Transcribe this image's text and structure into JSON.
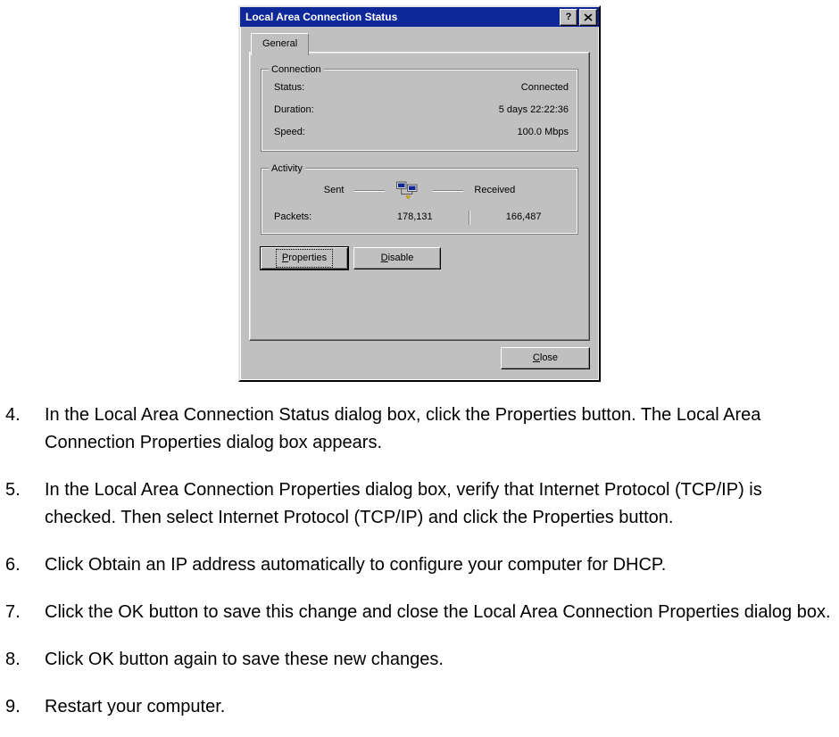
{
  "dialog": {
    "title": "Local Area Connection Status",
    "help_glyph": "?",
    "close_glyph": "×",
    "tab_general": "General",
    "group_connection": "Connection",
    "status_label": "Status:",
    "status_value": "Connected",
    "duration_label": "Duration:",
    "duration_value": "5 days 22:22:36",
    "speed_label": "Speed:",
    "speed_value": "100.0 Mbps",
    "group_activity": "Activity",
    "sent_label": "Sent",
    "received_label": "Received",
    "packets_label": "Packets:",
    "packets_sent": "178,131",
    "packets_recv": "166,487",
    "properties_label": "Properties",
    "disable_label": "Disable",
    "close_label": "Close"
  },
  "steps": [
    {
      "n": 4,
      "text": "In the Local Area Connection Status dialog box, click the Properties button. The Local Area Connection Properties dialog box appears."
    },
    {
      "n": 5,
      "text": "In the Local Area Connection Properties dialog box, verify that Internet Protocol (TCP/IP) is checked. Then select Internet Protocol (TCP/IP) and click the Properties button."
    },
    {
      "n": 6,
      "text": "Click Obtain an IP address automatically to configure your computer for DHCP."
    },
    {
      "n": 7,
      "text": "Click the OK button to save this change and close the Local Area Connection Properties dialog box."
    },
    {
      "n": 8,
      "text": "Click OK button again to save these new changes."
    },
    {
      "n": 9,
      "text": "Restart your computer."
    }
  ]
}
